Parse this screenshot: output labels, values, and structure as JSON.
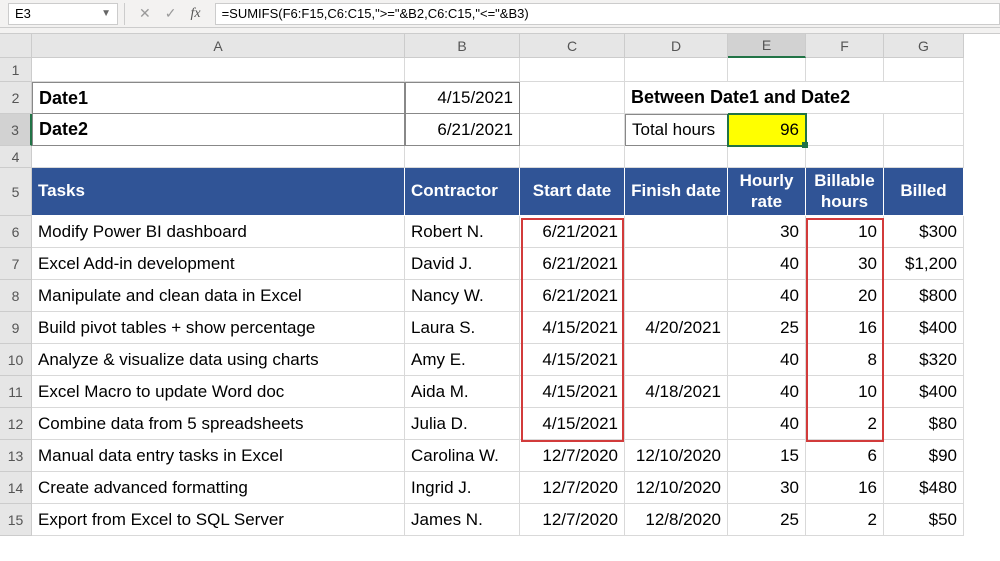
{
  "namebox": "E3",
  "formula": "=SUMIFS(F6:F15,C6:C15,\">=\"&B2,C6:C15,\"<=\"&B3)",
  "columns": [
    "A",
    "B",
    "C",
    "D",
    "E",
    "F",
    "G"
  ],
  "rows": [
    "1",
    "2",
    "3",
    "4",
    "5",
    "6",
    "7",
    "8",
    "9",
    "10",
    "11",
    "12",
    "13",
    "14",
    "15"
  ],
  "labels": {
    "date1": "Date1",
    "date2": "Date2",
    "date1_val": "4/15/2021",
    "date2_val": "6/21/2021",
    "between": "Between Date1 and Date2",
    "total_hours_label": "Total hours",
    "total_hours_val": "96"
  },
  "headers": {
    "tasks": "Tasks",
    "contractor": "Contractor",
    "start": "Start date",
    "finish": "Finish date",
    "rate": "Hourly rate",
    "hours": "Billable hours",
    "billed": "Billed"
  },
  "data": [
    {
      "task": "Modify Power BI dashboard",
      "contractor": "Robert N.",
      "start": "6/21/2021",
      "finish": "",
      "rate": "30",
      "hours": "10",
      "billed": "$300"
    },
    {
      "task": "Excel Add-in development",
      "contractor": "David J.",
      "start": "6/21/2021",
      "finish": "",
      "rate": "40",
      "hours": "30",
      "billed": "$1,200"
    },
    {
      "task": "Manipulate and clean data in Excel",
      "contractor": "Nancy W.",
      "start": "6/21/2021",
      "finish": "",
      "rate": "40",
      "hours": "20",
      "billed": "$800"
    },
    {
      "task": "Build pivot tables + show percentage",
      "contractor": "Laura S.",
      "start": "4/15/2021",
      "finish": "4/20/2021",
      "rate": "25",
      "hours": "16",
      "billed": "$400"
    },
    {
      "task": "Analyze & visualize data using charts",
      "contractor": "Amy E.",
      "start": "4/15/2021",
      "finish": "",
      "rate": "40",
      "hours": "8",
      "billed": "$320"
    },
    {
      "task": "Excel Macro to update Word doc",
      "contractor": "Aida M.",
      "start": "4/15/2021",
      "finish": "4/18/2021",
      "rate": "40",
      "hours": "10",
      "billed": "$400"
    },
    {
      "task": "Combine data from 5 spreadsheets",
      "contractor": "Julia D.",
      "start": "4/15/2021",
      "finish": "",
      "rate": "40",
      "hours": "2",
      "billed": "$80"
    },
    {
      "task": "Manual data entry tasks in Excel",
      "contractor": "Carolina W.",
      "start": "12/7/2020",
      "finish": "12/10/2020",
      "rate": "15",
      "hours": "6",
      "billed": "$90"
    },
    {
      "task": "Create advanced formatting",
      "contractor": "Ingrid J.",
      "start": "12/7/2020",
      "finish": "12/10/2020",
      "rate": "30",
      "hours": "16",
      "billed": "$480"
    },
    {
      "task": "Export from Excel to SQL Server",
      "contractor": "James N.",
      "start": "12/7/2020",
      "finish": "12/8/2020",
      "rate": "25",
      "hours": "2",
      "billed": "$50"
    }
  ]
}
